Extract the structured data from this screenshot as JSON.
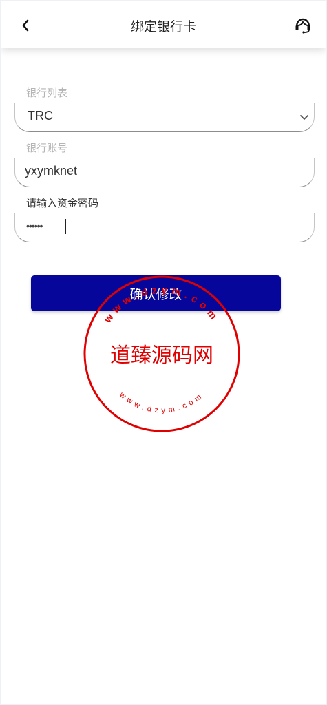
{
  "header": {
    "title": "绑定银行卡",
    "back_icon": "chevron-left-icon",
    "support_icon": "customer-service-icon"
  },
  "form": {
    "bank_list_label": "银行列表",
    "bank_selected": "TRC",
    "bank_account_label": "银行账号",
    "bank_account_value": "yxymknet",
    "password_label": "请输入资金密码",
    "password_mask": "••••••"
  },
  "confirm_label": "确认修改",
  "watermark": {
    "text": "道臻源码网",
    "ring_text": "www.dzym.com",
    "color": "#e00000"
  },
  "colors": {
    "accent": "#06069a"
  }
}
